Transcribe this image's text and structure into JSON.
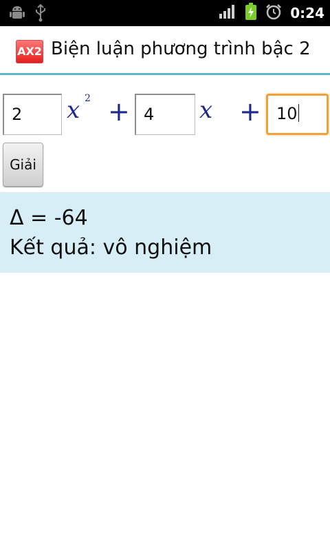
{
  "status_bar": {
    "time": "0:24",
    "icons": [
      "android-icon",
      "usb-icon",
      "signal-icon",
      "battery-charging-icon",
      "alarm-icon"
    ]
  },
  "app": {
    "icon_label": "AX2",
    "title": "Biện luận phương trình bậc 2"
  },
  "equation": {
    "a": "2",
    "b": "4",
    "c": "10",
    "var": "x",
    "exponent": "2",
    "plus": "+"
  },
  "solve_button": {
    "label": "Giải"
  },
  "result": {
    "delta_text": "Δ = -64",
    "conclusion_text": "Kết quả: vô nghiệm"
  },
  "colors": {
    "accent_divider": "#5fb6cf",
    "focus_border": "#f0a13a",
    "math_text": "#1d2a8c",
    "result_bg": "#d7eef6"
  }
}
